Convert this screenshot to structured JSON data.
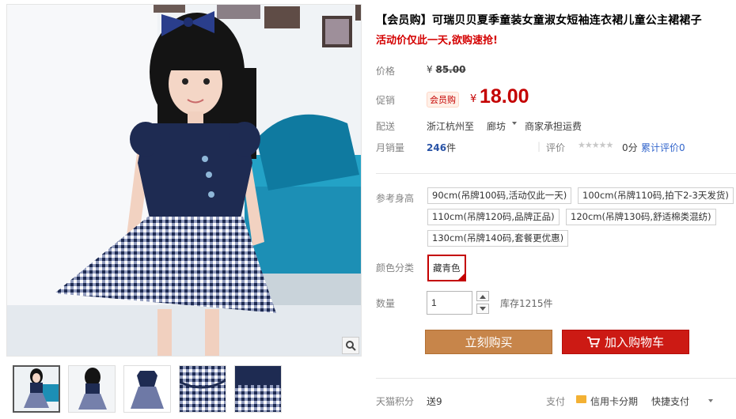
{
  "product": {
    "title": "【会员购】可瑞贝贝夏季童装女童淑女短袖连衣裙儿童公主裙裙子",
    "subtitle": "活动价仅此一天,欲购速抢!"
  },
  "price": {
    "label": "价格",
    "currency": "¥",
    "original": "85.00"
  },
  "promo": {
    "label": "促销",
    "tag": "会员购",
    "currency": "¥",
    "price": "18.00"
  },
  "shipping": {
    "label": "配送",
    "from": "浙江杭州",
    "to_label": "至",
    "destination": "廊坊",
    "note": "商家承担运费"
  },
  "sales": {
    "label": "月销量",
    "count": "246",
    "unit": "件",
    "rating_label": "评价",
    "stars": "★★★★★",
    "score": "0分",
    "review_link": "累计评价0"
  },
  "sizes": {
    "label": "参考身高",
    "options": [
      "90cm(吊牌100码,活动仅此一天)",
      "100cm(吊牌110码,拍下2-3天发货)",
      "110cm(吊牌120码,品牌正品)",
      "120cm(吊牌130码,舒适棉类混纺)",
      "130cm(吊牌140码,套餐更优惠)"
    ]
  },
  "colors": {
    "label": "颜色分类",
    "options": [
      "藏青色"
    ]
  },
  "quantity": {
    "label": "数量",
    "value": "1",
    "stock": "库存1215件"
  },
  "buttons": {
    "buy_now": "立刻购买",
    "add_cart": "加入购物车"
  },
  "bottom": {
    "points_label": "天猫积分",
    "points": "送9",
    "pay_label": "支付",
    "credit": "信用卡分期",
    "quick": "快捷支付"
  },
  "colors_theme": {
    "accent": "#c40000",
    "buy_button": "#c7854a",
    "cart_button": "#cc1a14",
    "link": "#3366cc"
  }
}
